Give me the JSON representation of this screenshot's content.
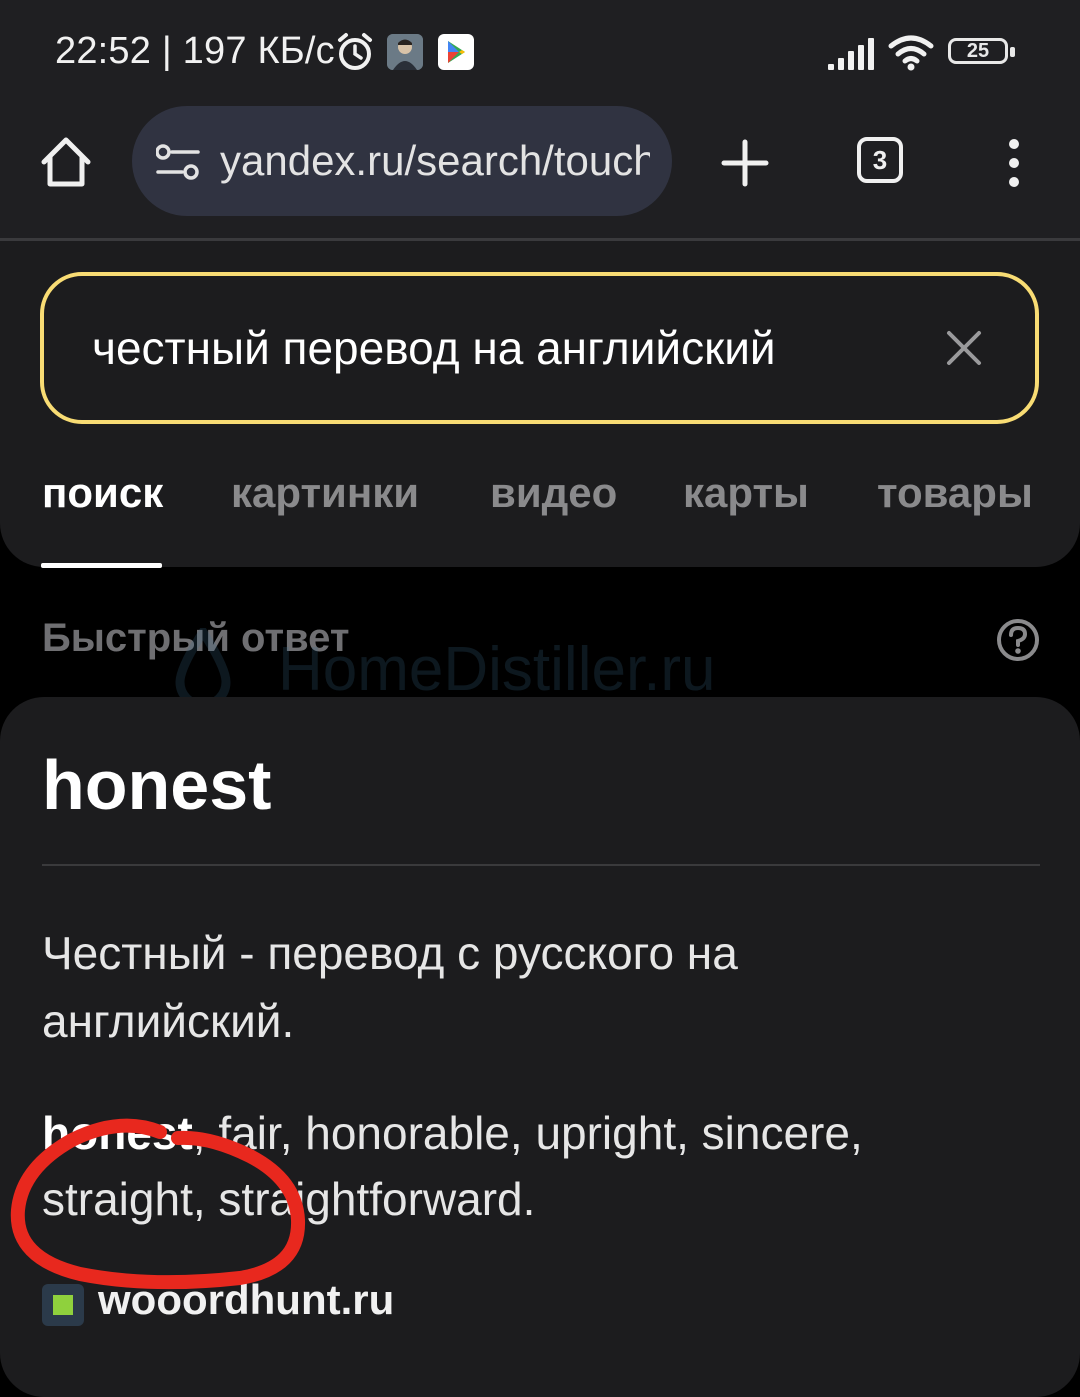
{
  "status_bar": {
    "time_speed": "22:52 | 197 КБ/с",
    "battery_level": "25",
    "icons": [
      "alarm-icon",
      "avatar-icon",
      "play-store-icon",
      "signal-icon",
      "wifi-icon",
      "battery-icon"
    ]
  },
  "browser": {
    "url": "yandex.ru/search/touch",
    "tab_count": "3",
    "icons": [
      "home-icon",
      "site-settings-icon",
      "plus-icon",
      "menu-dots-icon"
    ]
  },
  "search": {
    "query": "честный перевод на английский",
    "tabs": [
      {
        "label": "поиск",
        "active": true
      },
      {
        "label": "картинки",
        "active": false
      },
      {
        "label": "видео",
        "active": false
      },
      {
        "label": "карты",
        "active": false
      },
      {
        "label": "товары",
        "active": false
      }
    ]
  },
  "quick_answer": {
    "label": "Быстрый ответ",
    "watermark": "HomeDistiller.ru",
    "title": "honest",
    "description": "Честный - перевод с русского на английский.",
    "first_word": "honest",
    "other_words": ", fair, honorable, upright, sincere, straight, straightforward.",
    "source": "wooordhunt.ru"
  },
  "colors": {
    "search_border": "#f8dc74",
    "annotation": "#e8281e",
    "source_icon": "#8fd13d"
  }
}
